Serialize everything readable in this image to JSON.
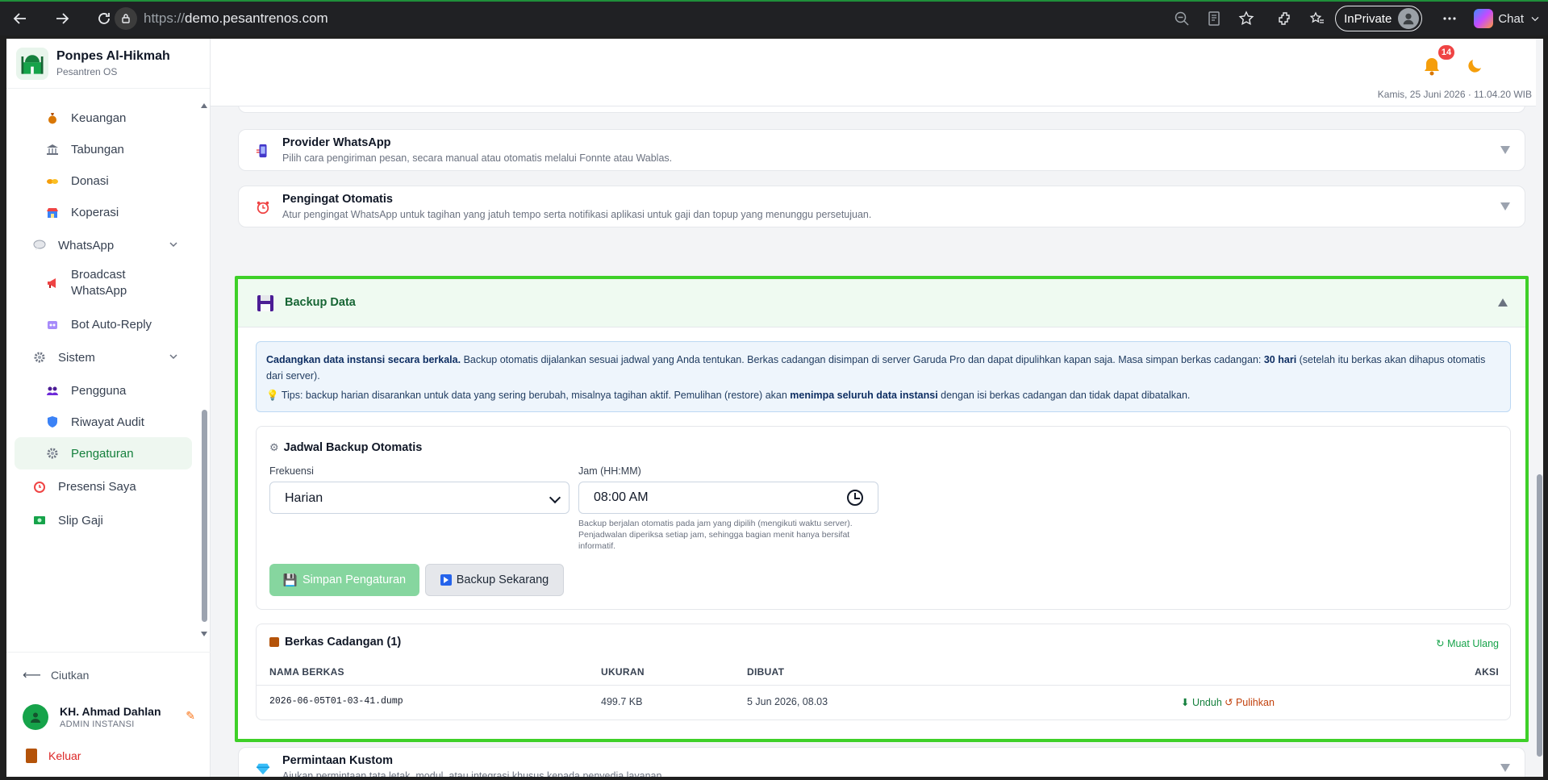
{
  "browser": {
    "url_scheme": "https://",
    "url_host": "demo.pesantrenos.com",
    "inprivate_label": "InPrivate",
    "chat_label": "Chat"
  },
  "sidebar": {
    "brand_name": "Ponpes Al-Hikmah",
    "brand_sub": "Pesantren OS",
    "items": [
      {
        "label": "Keuangan",
        "icon": "money-bag-icon"
      },
      {
        "label": "Tabungan",
        "icon": "bank-icon"
      },
      {
        "label": "Donasi",
        "icon": "handshake-icon"
      },
      {
        "label": "Koperasi",
        "icon": "shop-icon"
      },
      {
        "label": "WhatsApp",
        "icon": "chat-bubble-icon"
      },
      {
        "label": "Broadcast WhatsApp",
        "icon": "megaphone-icon"
      },
      {
        "label": "Bot Auto-Reply",
        "icon": "robot-icon"
      },
      {
        "label": "Sistem",
        "icon": "gear-icon"
      },
      {
        "label": "Pengguna",
        "icon": "users-icon"
      },
      {
        "label": "Riwayat Audit",
        "icon": "shield-icon"
      },
      {
        "label": "Pengaturan",
        "icon": "gear-icon"
      },
      {
        "label": "Presensi Saya",
        "icon": "alarm-clock-icon"
      },
      {
        "label": "Slip Gaji",
        "icon": "banknote-icon"
      }
    ],
    "collapse_label": "Ciutkan",
    "user_name": "KH. Ahmad Dahlan",
    "user_role": "ADMIN INSTANSI",
    "logout_label": "Keluar"
  },
  "header": {
    "notif_count": "14",
    "datetime": "Kamis, 25 Juni 2026 · 11.04.20 WIB"
  },
  "sections": {
    "whatsapp_provider": {
      "title": "Provider WhatsApp",
      "desc": "Pilih cara pengiriman pesan, secara manual atau otomatis melalui Fonnte atau Wablas."
    },
    "auto_reminder": {
      "title": "Pengingat Otomatis",
      "desc": "Atur pengingat WhatsApp untuk tagihan yang jatuh tempo serta notifikasi aplikasi untuk gaji dan topup yang menunggu persetujuan."
    },
    "backup": {
      "title": "Backup Data",
      "info_bold": "Cadangkan data instansi secara berkala.",
      "info_text": " Backup otomatis dijalankan sesuai jadwal yang Anda tentukan. Berkas cadangan disimpan di server Garuda Pro dan dapat dipulihkan kapan saja. Masa simpan berkas cadangan: ",
      "info_days": "30 hari",
      "info_after": " (setelah itu berkas akan dihapus otomatis dari server).",
      "tip_text": "Tips: backup harian disarankan untuk data yang sering berubah, misalnya tagihan aktif. Pemulihan (restore) akan ",
      "tip_bold": "menimpa seluruh data instansi",
      "tip_after": " dengan isi berkas cadangan dan tidak dapat dibatalkan.",
      "schedule_title": "Jadwal Backup Otomatis",
      "freq_label": "Frekuensi",
      "freq_value": "Harian",
      "time_label": "Jam (HH:MM)",
      "time_value": "08:00 AM",
      "hint": "Backup berjalan otomatis pada jam yang dipilih (mengikuti waktu server). Penjadwalan diperiksa setiap jam, sehingga bagian menit hanya bersifat informatif.",
      "save_label": "Simpan Pengaturan",
      "backup_now_label": "Backup Sekarang",
      "files_title": "Berkas Cadangan (1)",
      "reload_label": "↻ Muat Ulang",
      "columns": [
        "NAMA BERKAS",
        "UKURAN",
        "DIBUAT",
        "AKSI"
      ],
      "rows": [
        {
          "name": "2026-06-05T01-03-41.dump",
          "size": "499.7 KB",
          "created": "5 Jun 2026, 08.03",
          "download": "⬇ Unduh",
          "restore": "↺ Pulihkan"
        }
      ]
    },
    "custom_request": {
      "title": "Permintaan Kustom",
      "desc": "Ajukan permintaan tata letak, modul, atau integrasi khusus kepada penyedia layanan."
    }
  },
  "colors": {
    "accent_green": "#16a34a",
    "highlight_border": "#3ed028",
    "danger": "#dc2626"
  }
}
